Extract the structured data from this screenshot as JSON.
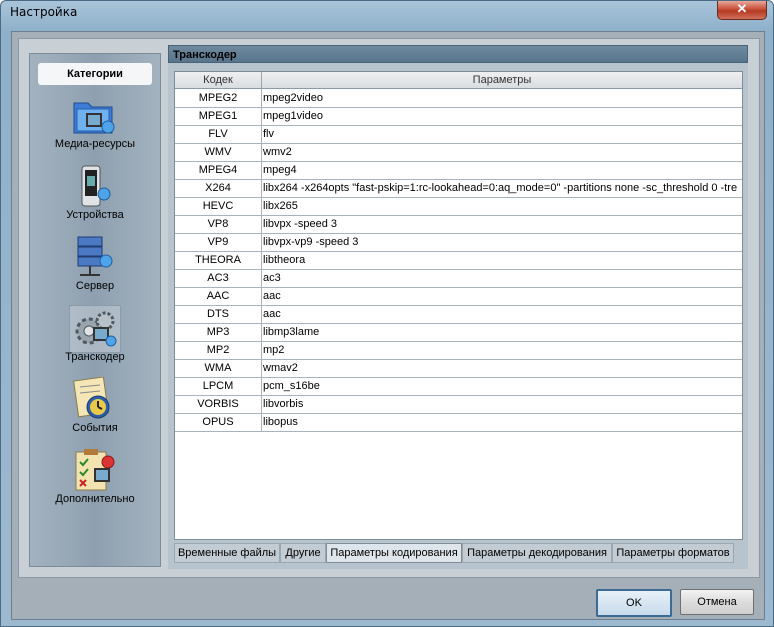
{
  "window": {
    "title": "Настройка",
    "close_glyph": "✕"
  },
  "sidebar": {
    "header": "Категории",
    "items": [
      {
        "label": "Медиа-ресурсы",
        "icon": "media-folder-icon"
      },
      {
        "label": "Устройства",
        "icon": "devices-icon"
      },
      {
        "label": "Сервер",
        "icon": "server-icon"
      },
      {
        "label": "Транскодер",
        "icon": "transcoder-gear-icon",
        "active": true
      },
      {
        "label": "События",
        "icon": "events-icon"
      },
      {
        "label": "Дополнительно",
        "icon": "advanced-checklist-icon"
      }
    ]
  },
  "panel": {
    "title": "Транскодер"
  },
  "table": {
    "columns": [
      "Кодек",
      "Параметры"
    ],
    "rows": [
      [
        "MPEG2",
        "mpeg2video"
      ],
      [
        "MPEG1",
        "mpeg1video"
      ],
      [
        "FLV",
        "flv"
      ],
      [
        "WMV",
        "wmv2"
      ],
      [
        "MPEG4",
        "mpeg4"
      ],
      [
        "X264",
        "libx264 -x264opts \"fast-pskip=1:rc-lookahead=0:aq_mode=0\" -partitions none -sc_threshold 0 -tre"
      ],
      [
        "HEVC",
        "libx265"
      ],
      [
        "VP8",
        "libvpx -speed 3"
      ],
      [
        "VP9",
        "libvpx-vp9 -speed 3"
      ],
      [
        "THEORA",
        "libtheora"
      ],
      [
        "AC3",
        "ac3"
      ],
      [
        "AAC",
        "aac"
      ],
      [
        "DTS",
        "aac"
      ],
      [
        "MP3",
        "libmp3lame"
      ],
      [
        "MP2",
        "mp2"
      ],
      [
        "WMA",
        "wmav2"
      ],
      [
        "LPCM",
        "pcm_s16be"
      ],
      [
        "VORBIS",
        "libvorbis"
      ],
      [
        "OPUS",
        "libopus"
      ]
    ]
  },
  "tabs": [
    {
      "label": "Временные файлы"
    },
    {
      "label": "Другие"
    },
    {
      "label": "Параметры кодирования",
      "active": true
    },
    {
      "label": "Параметры декодирования"
    },
    {
      "label": "Параметры форматов"
    }
  ],
  "buttons": {
    "ok": "OK",
    "cancel": "Отмена"
  }
}
